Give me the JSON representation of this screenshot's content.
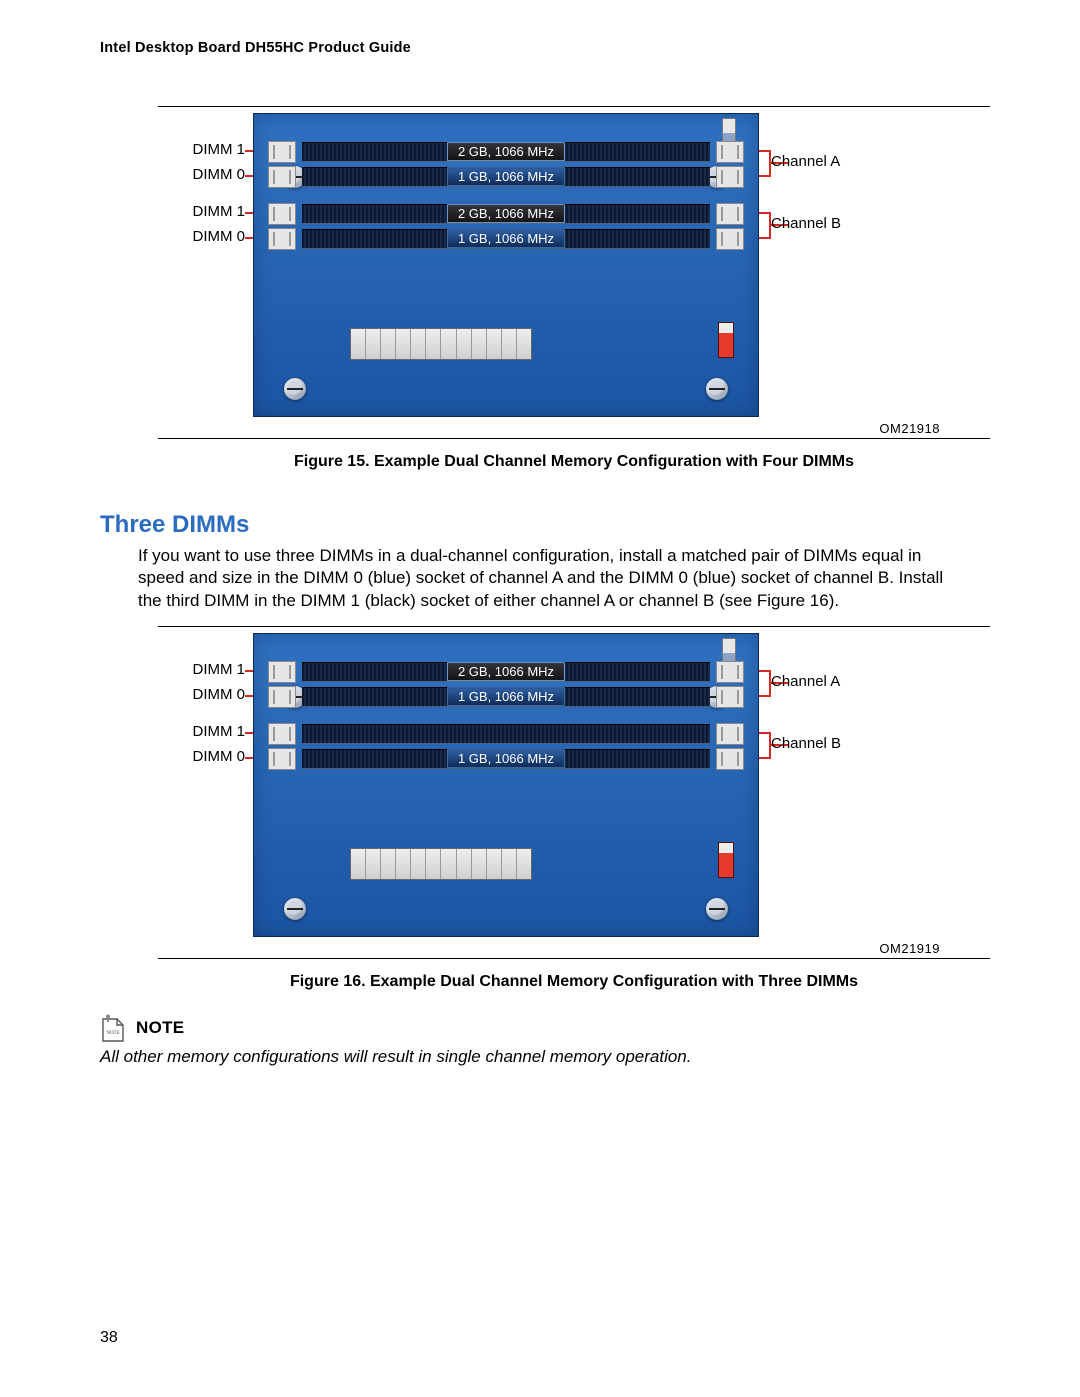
{
  "header": {
    "title": "Intel Desktop Board DH55HC Product Guide"
  },
  "figures": {
    "fig15": {
      "left_labels": [
        "DIMM 1",
        "DIMM 0",
        "DIMM 1",
        "DIMM 0"
      ],
      "right_labels": [
        "Channel A",
        "Channel B"
      ],
      "slot_labels": [
        "2 GB, 1066 MHz",
        "1 GB, 1066 MHz",
        "2 GB, 1066 MHz",
        "1 GB, 1066 MHz"
      ],
      "om": "OM21918",
      "caption": "Figure 15.  Example Dual Channel Memory Configuration with Four DIMMs"
    },
    "fig16": {
      "left_labels": [
        "DIMM 1",
        "DIMM 0",
        "DIMM 1",
        "DIMM 0"
      ],
      "right_labels": [
        "Channel A",
        "Channel B"
      ],
      "slot_labels": [
        "2 GB, 1066 MHz",
        "1 GB, 1066 MHz",
        "",
        "1 GB, 1066 MHz"
      ],
      "om": "OM21919",
      "caption": "Figure 16.  Example Dual Channel Memory Configuration with Three DIMMs"
    }
  },
  "section": {
    "heading": "Three DIMMs",
    "body": "If you want to use three DIMMs in a dual-channel configuration, install a matched pair of DIMMs equal in speed and size in the DIMM 0 (blue) socket of channel A and the DIMM 0 (blue) socket of channel B.  Install the third DIMM in the DIMM 1 (black) socket of either channel A or channel B (see Figure 16)."
  },
  "note": {
    "icon_text": "NOTE",
    "title": "NOTE",
    "body": "All other memory configurations will result in single channel memory operation."
  },
  "page_number": "38",
  "colors": {
    "heading_blue": "#2a6cc0",
    "leader_red": "#d42a22",
    "board_blue_top": "#2a6cc0",
    "board_blue_bottom": "#1b54a3"
  }
}
